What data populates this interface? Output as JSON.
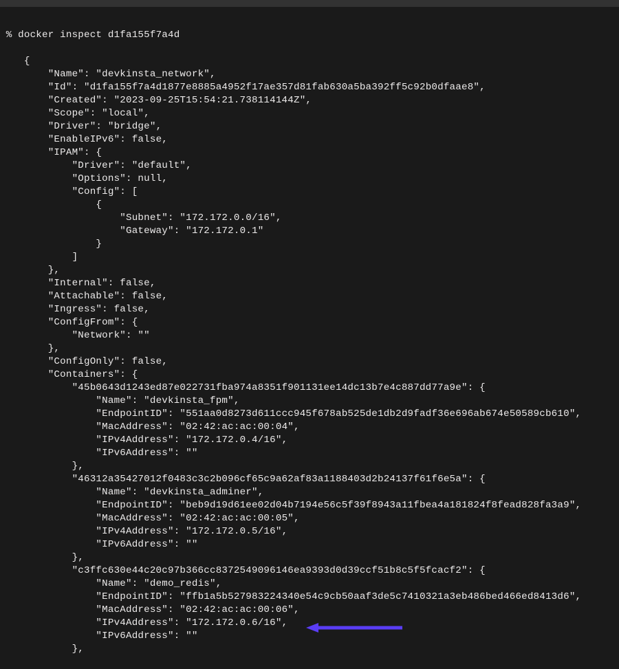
{
  "prompt": "%",
  "command": "docker inspect d1fa155f7a4d",
  "network": {
    "Name": "devkinsta_network",
    "Id": "d1fa155f7a4d1877e8885a4952f17ae357d81fab630a5ba392ff5c92b0dfaae8",
    "Created": "2023-09-25T15:54:21.738114144Z",
    "Scope": "local",
    "Driver": "bridge",
    "EnableIPv6": "false",
    "IPAM": {
      "Driver": "default",
      "Options": "null",
      "Config": {
        "Subnet": "172.172.0.0/16",
        "Gateway": "172.172.0.1"
      }
    },
    "Internal": "false",
    "Attachable": "false",
    "Ingress": "false",
    "ConfigFrom_Network": "",
    "ConfigOnly": "false",
    "Containers": {
      "c1_id": "45b0643d1243ed87e022731fba974a8351f901131ee14dc13b7e4c887dd77a9e",
      "c1_Name": "devkinsta_fpm",
      "c1_EndpointID": "551aa0d8273d611ccc945f678ab525de1db2d9fadf36e696ab674e50589cb610",
      "c1_MacAddress": "02:42:ac:ac:00:04",
      "c1_IPv4Address": "172.172.0.4/16",
      "c1_IPv6Address": "",
      "c2_id": "46312a35427012f0483c3c2b096cf65c9a62af83a1188403d2b24137f61f6e5a",
      "c2_Name": "devkinsta_adminer",
      "c2_EndpointID": "beb9d19d61ee02d04b7194e56c5f39f8943a11fbea4a181824f8fead828fa3a9",
      "c2_MacAddress": "02:42:ac:ac:00:05",
      "c2_IPv4Address": "172.172.0.5/16",
      "c2_IPv6Address": "",
      "c3_id": "c3ffc630e44c20c97b366cc8372549096146ea9393d0d39ccf51b8c5f5fcacf2",
      "c3_Name": "demo_redis",
      "c3_EndpointID": "ffb1a5b527983224340e54c9cb50aaf3de5c7410321a3eb486bed466ed8413d6",
      "c3_MacAddress": "02:42:ac:ac:00:06",
      "c3_IPv4Address": "172.172.0.6/16",
      "c3_IPv6Address": ""
    }
  }
}
